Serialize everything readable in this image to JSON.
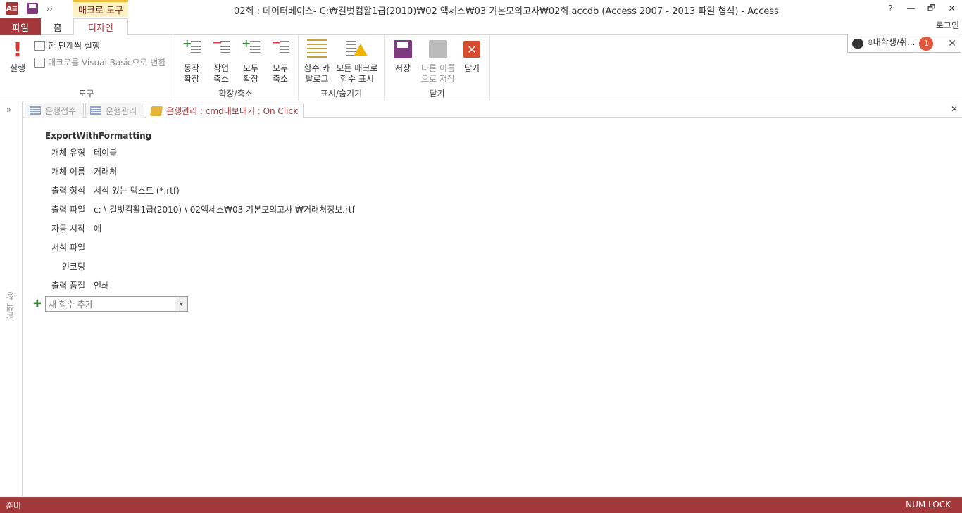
{
  "window": {
    "title": "02회 : 데이터베이스- C:₩길벗컴활1급(2010)₩02 액세스₩03 기본모의고사₩02회.accdb (Access 2007 - 2013 파일 형식) - Access",
    "app_icon": "A≡",
    "qat_more": "››",
    "help": "?",
    "minimize": "—",
    "restore": "🗗",
    "close": "✕",
    "login": "로그인"
  },
  "ribbon": {
    "context_tab_header": "매크로 도구",
    "tabs": {
      "file": "파일",
      "home": "홈",
      "design": "디자인"
    },
    "groups": {
      "tools": {
        "label": "도구",
        "run": "실행",
        "run_icon": "!",
        "single_step": "한 단계씩 실행",
        "convert_vb": "매크로를 Visual Basic으로 변환"
      },
      "expand": {
        "label": "확장/축소",
        "expand_actions": [
          "동작",
          "확장"
        ],
        "collapse_actions": [
          "작업",
          "축소"
        ],
        "expand_all": [
          "모두",
          "확장"
        ],
        "collapse_all": [
          "모두",
          "축소"
        ]
      },
      "showhide": {
        "label": "표시/숨기기",
        "catalog": [
          "함수 카",
          "탈로그"
        ],
        "all_functions": [
          "모든 매크로",
          "함수 표시"
        ]
      },
      "close": {
        "label": "닫기",
        "save": "저장",
        "save_as": [
          "다른 이름",
          "으로 저장"
        ],
        "close": "닫기",
        "close_icon": "✕"
      }
    },
    "collapse_glyph": "⌃"
  },
  "notification": {
    "text": "৪대학생/취...",
    "badge": "1",
    "close": "✕"
  },
  "nav_pane": {
    "toggle": "»",
    "label": "탐색 창"
  },
  "doc_tabs": [
    {
      "label": "운행접수",
      "active": false
    },
    {
      "label": "운행관리",
      "active": false
    },
    {
      "label": "운행관리 : cmd내보내기 : On Click",
      "active": true
    }
  ],
  "doc_close": "✕",
  "macro": {
    "action": "ExportWithFormatting",
    "arguments": [
      {
        "label": "개체 유형",
        "value": "테이블"
      },
      {
        "label": "개체 이름",
        "value": "거래처"
      },
      {
        "label": "출력 형식",
        "value": "서식 있는 텍스트 (*.rtf)"
      },
      {
        "label": "출력 파일",
        "value": "c: \\ 길벗컴활1급(2010) \\ 02액세스₩03 기본모의고사 ₩거래처정보.rtf"
      },
      {
        "label": "자동 시작",
        "value": "예"
      },
      {
        "label": "서식 파일",
        "value": ""
      },
      {
        "label": "인코딩",
        "value": ""
      },
      {
        "label": "출력 품질",
        "value": "인쇄"
      }
    ],
    "add_plus": "✚",
    "add_placeholder": "새 함수 추가",
    "add_arrow": "▾"
  },
  "status": {
    "left": "준비",
    "right": "NUM LOCK"
  }
}
